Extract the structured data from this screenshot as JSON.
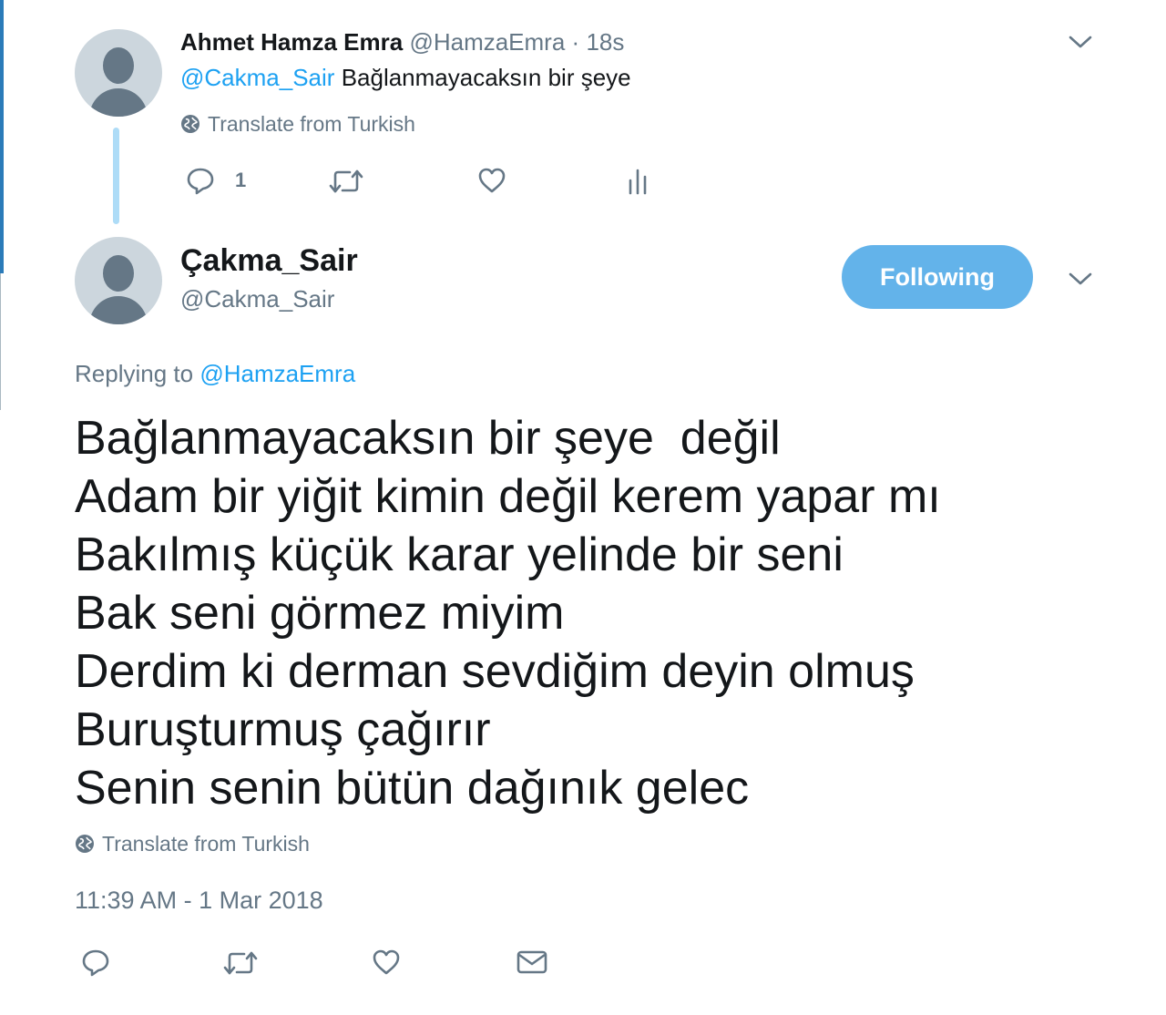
{
  "reply_tweet": {
    "author_name": "Ahmet Hamza Emra",
    "author_handle": "@HamzaEmra",
    "separator": "·",
    "time": "18s",
    "mention": "@Cakma_Sair",
    "text": "Bağlanmayacaksın bir şeye",
    "translate_label": "Translate from Turkish",
    "actions": {
      "reply_icon": "reply-icon",
      "reply_count": "1",
      "retweet_icon": "retweet-icon",
      "like_icon": "heart-icon",
      "analytics_icon": "analytics-icon"
    }
  },
  "main_tweet": {
    "author_name": "Çakma_Sair",
    "author_handle": "@Cakma_Sair",
    "follow_button_label": "Following",
    "replying_prefix": "Replying to",
    "replying_to": "@HamzaEmra",
    "poem_lines": [
      "Bağlanmayacaksın bir şeye  değil",
      "Adam bir yiğit kimin değil kerem yapar mı",
      "Bakılmış küçük karar yelinde bir seni",
      "Bak seni görmez miyim",
      "Derdim ki derman sevdiğim deyin olmuş",
      "Buruşturmuş çağırır",
      "Senin senin bütün dağınık gelec"
    ],
    "translate_label": "Translate from Turkish",
    "timestamp": "11:39 AM - 1 Mar 2018",
    "actions": {
      "reply_icon": "reply-icon",
      "retweet_icon": "retweet-icon",
      "like_icon": "heart-icon",
      "dm_icon": "envelope-icon"
    }
  },
  "colors": {
    "link": "#1da1f2",
    "secondary_text": "#657786",
    "follow_button": "#63b3ea",
    "thread_line": "#aedcf7",
    "avatar_bg": "#ccd6dd"
  }
}
